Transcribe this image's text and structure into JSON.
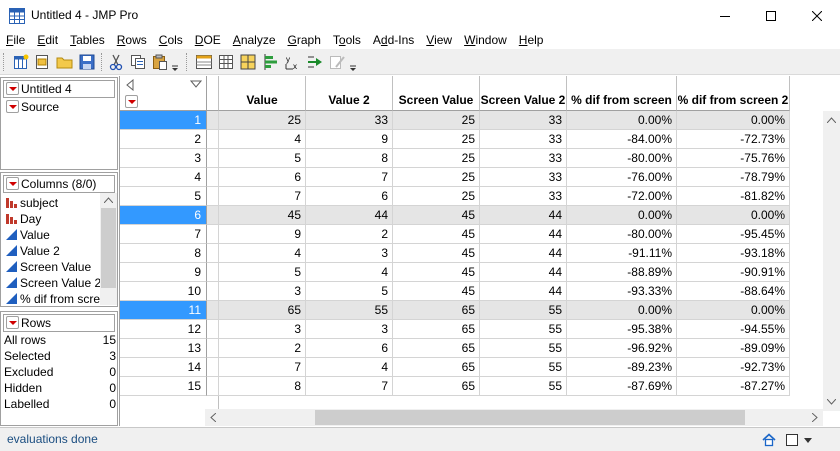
{
  "window": {
    "title": "Untitled 4 - JMP Pro"
  },
  "menu": [
    "File",
    "Edit",
    "Tables",
    "Rows",
    "Cols",
    "DOE",
    "Analyze",
    "Graph",
    "Tools",
    "Add-Ins",
    "View",
    "Window",
    "Help"
  ],
  "menu_underline": [
    "F",
    "E",
    "T",
    "R",
    "C",
    "D",
    "A",
    "G",
    "o",
    "d",
    "V",
    "W",
    "H"
  ],
  "toolbar_icons": [
    "new-data-table-icon",
    "open-icon",
    "open-folder-icon",
    "save-icon",
    "cut-icon",
    "copy-icon",
    "paste-icon",
    "data-view-icon",
    "table-icon",
    "grid-icon",
    "distribution-icon",
    "fit-y-by-x-icon",
    "fit-model-icon",
    "edit-icon"
  ],
  "table_panel": {
    "name": "Untitled 4",
    "source": "Source"
  },
  "columns_panel": {
    "header": "Columns (8/0)",
    "items": [
      {
        "label": "subject",
        "type": "nominal"
      },
      {
        "label": "Day",
        "type": "nominal"
      },
      {
        "label": "Value",
        "type": "continuous"
      },
      {
        "label": "Value 2",
        "type": "continuous"
      },
      {
        "label": "Screen Value",
        "type": "continuous"
      },
      {
        "label": "Screen Value 2",
        "type": "continuous"
      },
      {
        "label": "% dif from scre",
        "type": "continuous"
      }
    ]
  },
  "rows_panel": {
    "header": "Rows",
    "stats": [
      {
        "label": "All rows",
        "value": "15"
      },
      {
        "label": "Selected",
        "value": "3"
      },
      {
        "label": "Excluded",
        "value": "0"
      },
      {
        "label": "Hidden",
        "value": "0"
      },
      {
        "label": "Labelled",
        "value": "0"
      }
    ]
  },
  "table": {
    "columns": [
      "Value",
      "Value 2",
      "Screen Value",
      "Screen Value 2",
      "% dif from screen",
      "% dif from screen 2"
    ],
    "rows": [
      {
        "n": "1",
        "selected": true,
        "cells": [
          "25",
          "33",
          "25",
          "33",
          "0.00%",
          "0.00%"
        ]
      },
      {
        "n": "2",
        "selected": false,
        "cells": [
          "4",
          "9",
          "25",
          "33",
          "-84.00%",
          "-72.73%"
        ]
      },
      {
        "n": "3",
        "selected": false,
        "cells": [
          "5",
          "8",
          "25",
          "33",
          "-80.00%",
          "-75.76%"
        ]
      },
      {
        "n": "4",
        "selected": false,
        "cells": [
          "6",
          "7",
          "25",
          "33",
          "-76.00%",
          "-78.79%"
        ]
      },
      {
        "n": "5",
        "selected": false,
        "cells": [
          "7",
          "6",
          "25",
          "33",
          "-72.00%",
          "-81.82%"
        ]
      },
      {
        "n": "6",
        "selected": true,
        "cells": [
          "45",
          "44",
          "45",
          "44",
          "0.00%",
          "0.00%"
        ]
      },
      {
        "n": "7",
        "selected": false,
        "cells": [
          "9",
          "2",
          "45",
          "44",
          "-80.00%",
          "-95.45%"
        ]
      },
      {
        "n": "8",
        "selected": false,
        "cells": [
          "4",
          "3",
          "45",
          "44",
          "-91.11%",
          "-93.18%"
        ]
      },
      {
        "n": "9",
        "selected": false,
        "cells": [
          "5",
          "4",
          "45",
          "44",
          "-88.89%",
          "-90.91%"
        ]
      },
      {
        "n": "10",
        "selected": false,
        "cells": [
          "3",
          "5",
          "45",
          "44",
          "-93.33%",
          "-88.64%"
        ]
      },
      {
        "n": "11",
        "selected": true,
        "cells": [
          "65",
          "55",
          "65",
          "55",
          "0.00%",
          "0.00%"
        ]
      },
      {
        "n": "12",
        "selected": false,
        "cells": [
          "3",
          "3",
          "65",
          "55",
          "-95.38%",
          "-94.55%"
        ]
      },
      {
        "n": "13",
        "selected": false,
        "cells": [
          "2",
          "6",
          "65",
          "55",
          "-96.92%",
          "-89.09%"
        ]
      },
      {
        "n": "14",
        "selected": false,
        "cells": [
          "7",
          "4",
          "65",
          "55",
          "-89.23%",
          "-92.73%"
        ]
      },
      {
        "n": "15",
        "selected": false,
        "cells": [
          "8",
          "7",
          "65",
          "55",
          "-87.69%",
          "-87.27%"
        ]
      }
    ]
  },
  "status": {
    "text": "evaluations done"
  },
  "colors": {
    "selection": "#3399ff",
    "selected_row_bg": "#e5e5e5",
    "dropdown_red": "#d00000",
    "nominal_red": "#c0392b",
    "continuous_blue": "#1f5fbf",
    "status_text": "#1a4d80"
  }
}
